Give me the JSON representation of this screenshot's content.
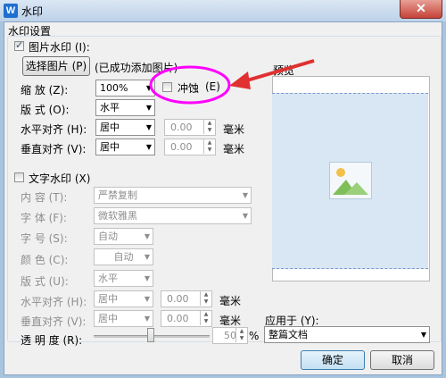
{
  "window": {
    "title": "水印",
    "app_icon": "W",
    "close": "✕"
  },
  "group_title": "水印设置",
  "picture": {
    "checkbox_label": "图片水印 (I):",
    "checked": true,
    "select_button": "选择图片 (P)",
    "status": "(已成功添加图片)",
    "scale_label": "缩    放 (Z):",
    "scale_value": "100%",
    "washout_label": "冲蚀",
    "washout_key": "(E)",
    "layout_label": "版    式 (O):",
    "layout_value": "水平",
    "halign_label": "水平对齐 (H):",
    "halign_value": "居中",
    "halign_offset": "0.00",
    "valign_label": "垂直对齐 (V):",
    "valign_value": "居中",
    "valign_offset": "0.00",
    "unit": "毫米"
  },
  "text": {
    "checkbox_label": "文字水印 (X)",
    "checked": false,
    "content_label": "内    容 (T):",
    "content_value": "严禁复制",
    "font_label": "字    体 (F):",
    "font_value": "微软雅黑",
    "size_label": "字    号 (S):",
    "size_value": "自动",
    "color_label": "颜    色 (C):",
    "color_value": "自动",
    "layout_label": "版    式 (U):",
    "layout_value": "水平",
    "halign_label": "水平对齐 (H):",
    "halign_value": "居中",
    "halign_offset": "0.00",
    "valign_label": "垂直对齐 (V):",
    "valign_value": "居中",
    "valign_offset": "0.00",
    "unit": "毫米",
    "transparency_label": "透 明 度 (R):",
    "transparency_value": "50",
    "transparency_unit": "%"
  },
  "preview_label": "预览",
  "apply_label": "应用于 (Y):",
  "apply_value": "整篇文档",
  "buttons": {
    "ok": "确定",
    "cancel": "取消"
  },
  "colors": {
    "highlight_ellipse": "#ff00ff",
    "arrow": "#e03030",
    "preview_bg": "#d9e7f5"
  }
}
